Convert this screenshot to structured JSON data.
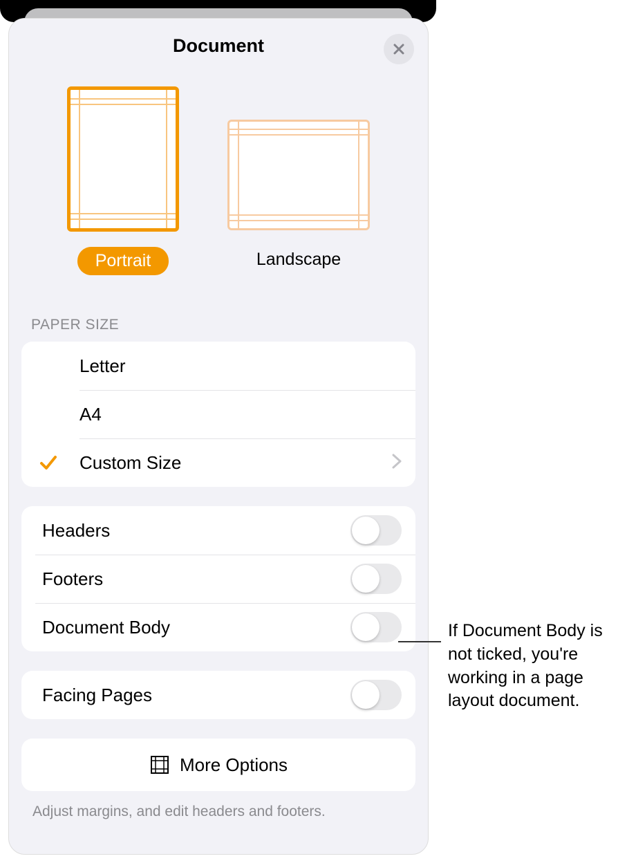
{
  "header": {
    "title": "Document"
  },
  "orientation": {
    "portrait_label": "Portrait",
    "landscape_label": "Landscape",
    "selected": "portrait"
  },
  "paper_size": {
    "section_label": "PAPER SIZE",
    "options": [
      {
        "label": "Letter",
        "selected": false,
        "disclosure": false
      },
      {
        "label": "A4",
        "selected": false,
        "disclosure": false
      },
      {
        "label": "Custom Size",
        "selected": true,
        "disclosure": true
      }
    ]
  },
  "toggles": [
    {
      "label": "Headers",
      "on": false
    },
    {
      "label": "Footers",
      "on": false
    },
    {
      "label": "Document Body",
      "on": false
    }
  ],
  "facing_pages": {
    "label": "Facing Pages",
    "on": false
  },
  "more_options": {
    "label": "More Options"
  },
  "footer_note": "Adjust margins, and edit headers and footers.",
  "callout": "If Document Body is not ticked, you're working in a page layout document."
}
